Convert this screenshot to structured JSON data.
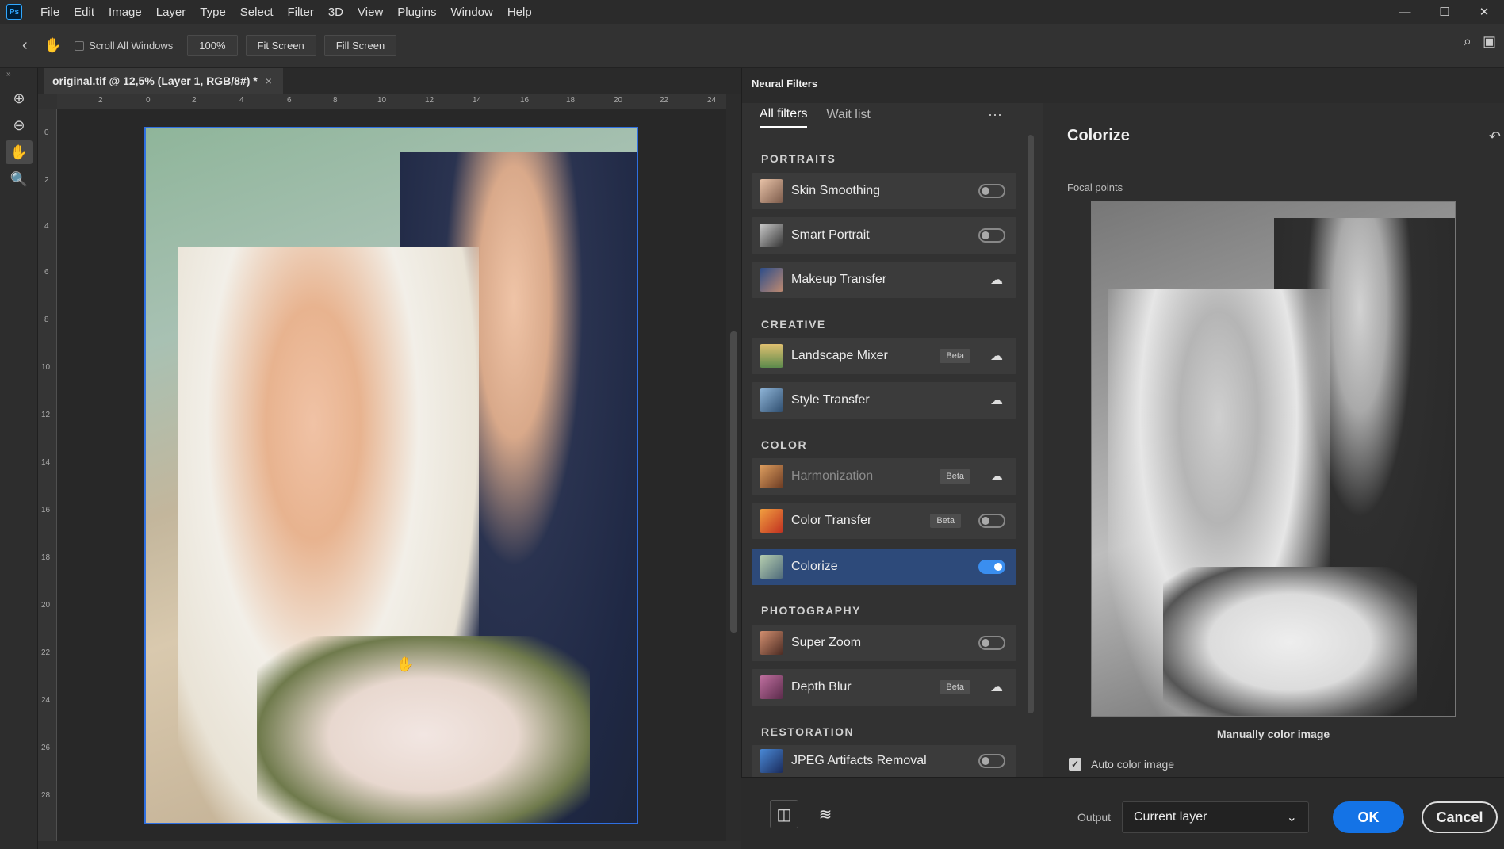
{
  "app": {
    "logo": "Ps"
  },
  "menu": [
    "File",
    "Edit",
    "Image",
    "Layer",
    "Type",
    "Select",
    "Filter",
    "3D",
    "View",
    "Plugins",
    "Window",
    "Help"
  ],
  "options": {
    "scroll_all_windows": "Scroll All Windows",
    "zoom": "100%",
    "fit_screen": "Fit Screen",
    "fill_screen": "Fill Screen"
  },
  "document": {
    "tab_title": "original.tif @ 12,5% (Layer 1, RGB/8#) *",
    "close": "×",
    "ruler_top": [
      "2",
      "0",
      "2",
      "4",
      "6",
      "8",
      "10",
      "12",
      "14",
      "16",
      "18",
      "20",
      "22",
      "24"
    ],
    "ruler_left": [
      "0",
      "2",
      "4",
      "6",
      "8",
      "10",
      "12",
      "14",
      "16",
      "18",
      "20",
      "22",
      "24",
      "26",
      "28"
    ]
  },
  "neural_filters": {
    "panel_title": "Neural Filters",
    "tabs": [
      "All filters",
      "Wait list"
    ],
    "more": "···",
    "categories": {
      "portraits": "PORTRAITS",
      "creative": "CREATIVE",
      "color": "COLOR",
      "photography": "PHOTOGRAPHY",
      "restoration": "RESTORATION"
    },
    "items": {
      "skin_smoothing": "Skin Smoothing",
      "smart_portrait": "Smart Portrait",
      "makeup_transfer": "Makeup Transfer",
      "landscape_mixer": "Landscape Mixer",
      "style_transfer": "Style Transfer",
      "harmonization": "Harmonization",
      "color_transfer": "Color Transfer",
      "colorize": "Colorize",
      "super_zoom": "Super Zoom",
      "depth_blur": "Depth Blur",
      "jpeg_artifacts": "JPEG Artifacts Removal"
    },
    "beta": "Beta"
  },
  "settings": {
    "title": "Colorize",
    "focal_points": "Focal points",
    "manually_color": "Manually color image",
    "auto_color": "Auto color image",
    "output_label": "Output",
    "output_value": "Current layer",
    "ok": "OK",
    "cancel": "Cancel"
  },
  "colors": {
    "accent": "#1473e6",
    "selected_row": "#2d4a7a",
    "toggle_on": "#3a8eef"
  }
}
